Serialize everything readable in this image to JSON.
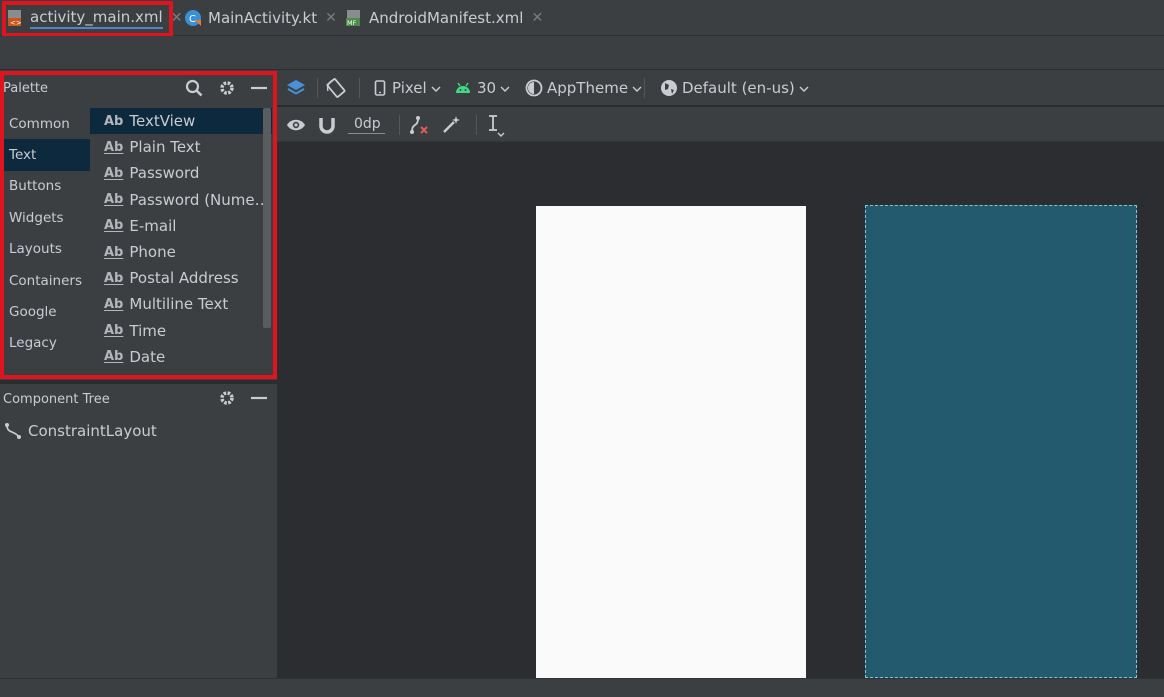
{
  "tabs": [
    {
      "label": "activity_main.xml",
      "icon": "layout-xml-file-icon",
      "active": true
    },
    {
      "label": "MainActivity.kt",
      "icon": "kotlin-class-icon",
      "active": false
    },
    {
      "label": "AndroidManifest.xml",
      "icon": "manifest-file-icon",
      "active": false
    }
  ],
  "palette": {
    "title": "Palette",
    "categories": [
      "Common",
      "Text",
      "Buttons",
      "Widgets",
      "Layouts",
      "Containers",
      "Google",
      "Legacy"
    ],
    "selected_category": "Text",
    "widget_icon_text": "Ab",
    "widgets": [
      "TextView",
      "Plain Text",
      "Password",
      "Password (Nume…",
      "E-mail",
      "Phone",
      "Postal Address",
      "Multiline Text",
      "Time",
      "Date"
    ],
    "selected_widget": "TextView"
  },
  "component_tree": {
    "title": "Component Tree",
    "root": "ConstraintLayout"
  },
  "toolbar": {
    "device": "Pixel",
    "api_level": "30",
    "theme": "AppTheme",
    "locale": "Default (en-us)",
    "margin": "0dp"
  },
  "colors": {
    "highlight": "#e0141e",
    "selection": "#0d293e",
    "blueprint": "#235a6e",
    "design_surface": "#fafafa",
    "android_green": "#3ddc84"
  }
}
